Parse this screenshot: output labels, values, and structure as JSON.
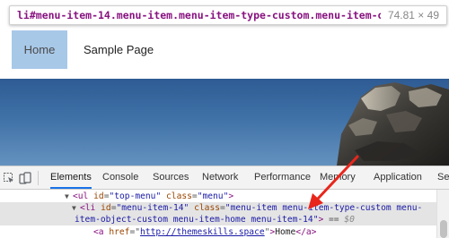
{
  "tooltip": {
    "selector": "li#menu-item-14.menu-item.menu-item-type-custom.menu-item-object...",
    "dimensions": "74.81 × 49"
  },
  "site_menu": {
    "items": [
      {
        "label": "Home",
        "active": true
      },
      {
        "label": "Sample Page",
        "active": false
      }
    ]
  },
  "devtools": {
    "tabs": [
      {
        "label": "Elements",
        "active": true
      },
      {
        "label": "Console"
      },
      {
        "label": "Sources"
      },
      {
        "label": "Network"
      },
      {
        "label": "Performance"
      },
      {
        "label": "Memory"
      },
      {
        "label": "Application"
      },
      {
        "label": "Se"
      }
    ],
    "dom": {
      "ul": {
        "tag": "ul",
        "id_attr": "id",
        "id_val": "\"top-menu\"",
        "class_attr": "class",
        "class_val": "\"menu\""
      },
      "li": {
        "tag": "li",
        "id_attr": "id",
        "id_val": "\"menu-item-14\"",
        "class_attr": "class",
        "class_val_line1": "\"menu-item menu-item-type-custom menu-",
        "class_val_line2": "item-object-custom menu-item-home menu-item-14\"",
        "eq": "==",
        "ref": "$0"
      },
      "a": {
        "tag": "a",
        "href_attr": "href",
        "href_val": "http://themeskills.space",
        "text": "Home",
        "close_tag": "a"
      }
    }
  },
  "colors": {
    "highlight_box": "#a8c8e8",
    "arrow": "#e8261c",
    "active_tab_underline": "#1a73e8",
    "selected_row": "#e4e4e4"
  }
}
